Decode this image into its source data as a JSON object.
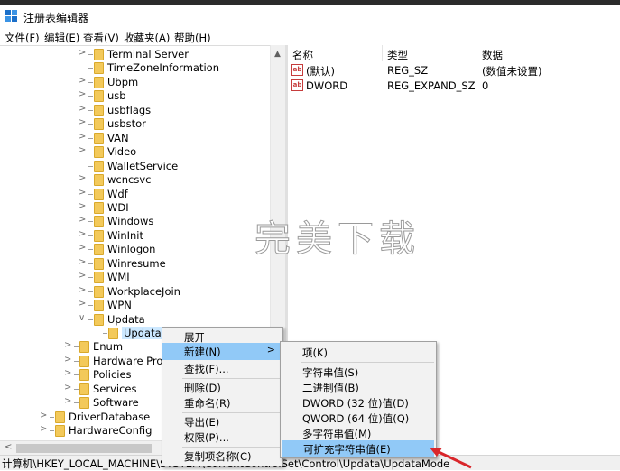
{
  "window": {
    "title": "注册表编辑器"
  },
  "menu": [
    "文件(F)",
    "编辑(E)",
    "查看(V)",
    "收藏夹(A)",
    "帮助(H)"
  ],
  "tree": {
    "nodes": [
      {
        "label": "Terminal Server",
        "chev": ">"
      },
      {
        "label": "TimeZoneInformation",
        "chev": ""
      },
      {
        "label": "Ubpm",
        "chev": ">"
      },
      {
        "label": "usb",
        "chev": ">"
      },
      {
        "label": "usbflags",
        "chev": ">"
      },
      {
        "label": "usbstor",
        "chev": ">"
      },
      {
        "label": "VAN",
        "chev": ">"
      },
      {
        "label": "Video",
        "chev": ">"
      },
      {
        "label": "WalletService",
        "chev": ""
      },
      {
        "label": "wcncsvc",
        "chev": ">"
      },
      {
        "label": "Wdf",
        "chev": ">"
      },
      {
        "label": "WDI",
        "chev": ">"
      },
      {
        "label": "Windows",
        "chev": ">"
      },
      {
        "label": "WinInit",
        "chev": ">"
      },
      {
        "label": "Winlogon",
        "chev": ">"
      },
      {
        "label": "Winresume",
        "chev": ">"
      },
      {
        "label": "WMI",
        "chev": ">"
      },
      {
        "label": "WorkplaceJoin",
        "chev": ">"
      },
      {
        "label": "WPN",
        "chev": ">"
      },
      {
        "label": "Updata",
        "chev": "∨"
      },
      {
        "label": "UpdataMo",
        "chev": ""
      },
      {
        "label": "Enum",
        "chev": ">"
      },
      {
        "label": "Hardware Profi",
        "chev": ">"
      },
      {
        "label": "Policies",
        "chev": ">"
      },
      {
        "label": "Services",
        "chev": ">"
      },
      {
        "label": "Software",
        "chev": ">"
      },
      {
        "label": "DriverDatabase",
        "chev": ">"
      },
      {
        "label": "HardwareConfig",
        "chev": ">"
      }
    ]
  },
  "list": {
    "headers": {
      "name": "名称",
      "type": "类型",
      "data": "数据"
    },
    "icon_label": "ab",
    "rows": [
      {
        "name": "(默认)",
        "type": "REG_SZ",
        "data": "(数值未设置)"
      },
      {
        "name": "DWORD",
        "type": "REG_EXPAND_SZ",
        "data": "0"
      }
    ]
  },
  "watermark": "完美下载",
  "context_menu": {
    "items": [
      "展开",
      "新建(N)",
      "查找(F)...",
      "删除(D)",
      "重命名(R)",
      "导出(E)",
      "权限(P)...",
      "复制项名称(C)"
    ],
    "submenu_arrow": ">"
  },
  "submenu": {
    "items": [
      "项(K)",
      "字符串值(S)",
      "二进制值(B)",
      "DWORD (32 位)值(D)",
      "QWORD (64 位)值(Q)",
      "多字符串值(M)",
      "可扩充字符串值(E)"
    ]
  },
  "statusbar": {
    "path": "计算机\\HKEY_LOCAL_MACHINE\\SYSTEM\\CurrentControlSet\\Control\\Updata\\UpdataMode"
  },
  "colors": {
    "highlight": "#91c9f7",
    "selected": "#cce8ff",
    "folder": "#f3c95a",
    "arrow": "#d9262b"
  }
}
